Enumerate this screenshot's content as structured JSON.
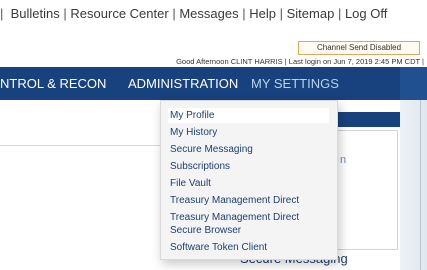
{
  "top_links": {
    "leading_separator": "|",
    "items": [
      "Bulletins",
      "Resource Center",
      "Messages",
      "Help",
      "Sitemap",
      "Log Off"
    ],
    "separator": "|"
  },
  "channel_badge": "Channel Send Disabled",
  "greeting": "Good Afternoon CLINT HARRIS | Last login on Jun 7, 2019 2:45 PM CDT |",
  "nav": {
    "items": [
      {
        "label": "NTROL & RECON"
      },
      {
        "label": "ADMINISTRATION"
      },
      {
        "label": "MY SETTINGS"
      }
    ],
    "active": "MY SETTINGS"
  },
  "dropdown": {
    "items": [
      "My Profile",
      "My History",
      "Secure Messaging",
      "Subscriptions",
      "File Vault",
      "Treasury Management Direct",
      "Treasury Management Direct Secure Browser",
      "Software Token Client"
    ],
    "hovered_index": 0
  },
  "background": {
    "card_partial_text": "n",
    "bottom_partial_text": "Secure Messaging"
  },
  "colors": {
    "nav_bg": "#17427d",
    "menu_text": "#1e3f74",
    "badge_border": "#e2a75a"
  }
}
